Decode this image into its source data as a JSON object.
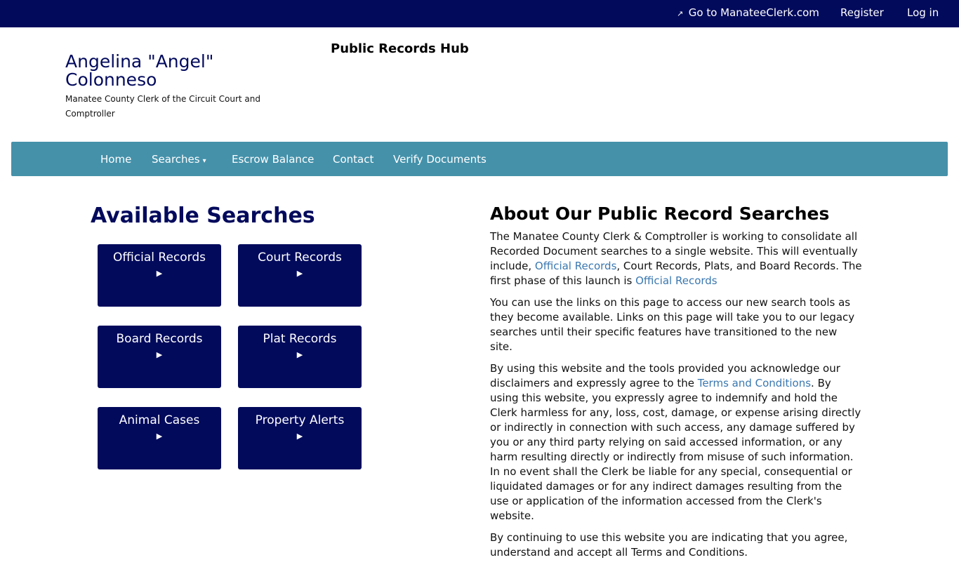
{
  "topbar": {
    "goto_icon": "external-link-icon",
    "goto_label": "Go to ManateeClerk.com",
    "register_label": "Register",
    "login_label": "Log in"
  },
  "header": {
    "name": "Angelina \"Angel\" Colonneso",
    "subtitle": "Manatee County Clerk of the Circuit Court and Comptroller",
    "hub_title": "Public Records Hub"
  },
  "nav": {
    "home": "Home",
    "searches": "Searches",
    "escrow": "Escrow Balance",
    "contact": "Contact",
    "verify": "Verify Documents"
  },
  "searches": {
    "title": "Available Searches",
    "tiles": [
      {
        "label": "Official Records",
        "icon": "arrow-icon"
      },
      {
        "label": "Court Records",
        "icon": "arrow-icon"
      },
      {
        "label": "Board Records",
        "icon": "arrow-icon"
      },
      {
        "label": "Plat Records",
        "icon": "arrow-icon"
      },
      {
        "label": "Animal Cases",
        "icon": "arrow-icon"
      },
      {
        "label": "Property Alerts",
        "icon": "arrow-icon"
      }
    ]
  },
  "about": {
    "title": "About Our Public Record Searches",
    "p1_a": "The Manatee County Clerk & Comptroller is working to consolidate all Recorded Document searches to a single website. This will eventually include, ",
    "p1_link1": "Official Records",
    "p1_b": ", Court Records, Plats, and Board Records. The first phase of this launch is ",
    "p1_link2": "Official Records",
    "p2": "You can use the links on this page to access our new search tools as they become available. Links on this page will take you to our legacy searches until their specific features have transitioned to the new site.",
    "p3_a": "By using this website and the tools provided you acknowledge our disclaimers and expressly agree to the ",
    "p3_link": "Terms and Conditions",
    "p3_b": ". By using this website, you expressly agree to indemnify and hold the Clerk harmless for any, loss, cost, damage, or expense arising directly or indirectly in connection with such access, any damage suffered by you or any third party relying on said accessed information, or any harm resulting directly or indirectly from misuse of such information. In no event shall the Clerk be liable for any special, consequential or liquidated damages or for any indirect damages resulting from the use or application of the information accessed from the Clerk's website.",
    "p4": "By continuing to use this website you are indicating that you agree, understand and accept all Terms and Conditions."
  },
  "colors": {
    "navy": "#020a5c",
    "nav_teal": "#4591aa",
    "link": "#3a78b0"
  }
}
